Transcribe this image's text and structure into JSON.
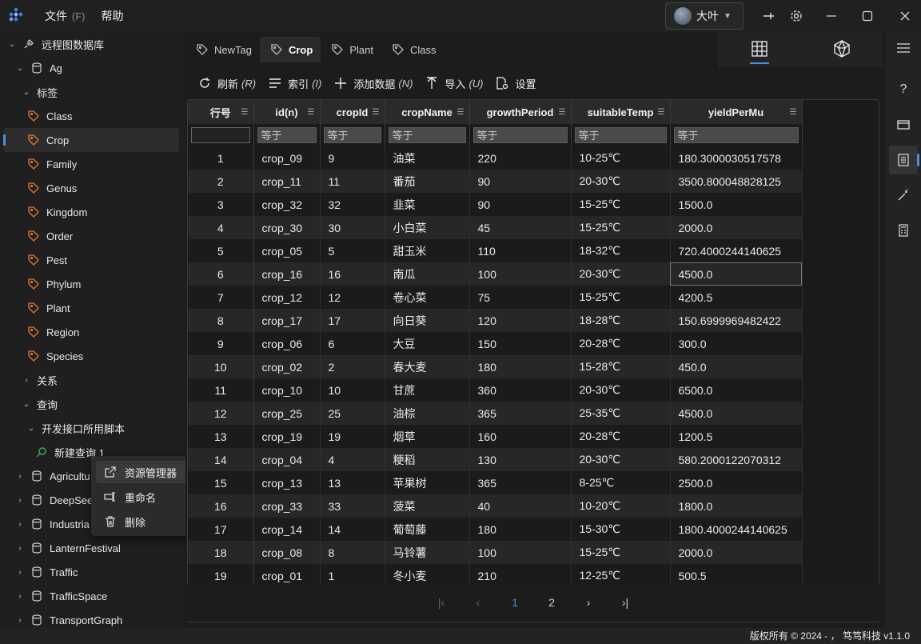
{
  "titlebar": {
    "menus": [
      {
        "label": "文件",
        "hint": "(F)"
      },
      {
        "label": "帮助",
        "hint": ""
      }
    ],
    "user_name": "大叶"
  },
  "sidebar": {
    "root": "远程图数据库",
    "db": "Ag",
    "tags_group": "标签",
    "tags": [
      "Class",
      "Crop",
      "Family",
      "Genus",
      "Kingdom",
      "Order",
      "Pest",
      "Phylum",
      "Plant",
      "Region",
      "Species"
    ],
    "selected_tag": "Crop",
    "relations_group": "关系",
    "query_group": "查询",
    "script_group": "开发接口所用脚本",
    "new_query": "新建查询 1",
    "databases": [
      "Agricultu",
      "DeepSee",
      "Industria",
      "LanternFestival",
      "Traffic",
      "TrafficSpace",
      "TransportGraph"
    ]
  },
  "context_menu": {
    "items": [
      "资源管理器",
      "重命名",
      "删除"
    ]
  },
  "tabs": [
    {
      "label": "NewTag",
      "active": false
    },
    {
      "label": "Crop",
      "active": true
    },
    {
      "label": "Plant",
      "active": false
    },
    {
      "label": "Class",
      "active": false
    }
  ],
  "toolbar": {
    "refresh": "刷新",
    "refresh_hint": "(R)",
    "index": "索引",
    "index_hint": "(I)",
    "add": "添加数据",
    "add_hint": "(N)",
    "import": "导入",
    "import_hint": "(U)",
    "settings": "设置"
  },
  "table": {
    "columns": [
      "行号",
      "id(n)",
      "cropId",
      "cropName",
      "growthPeriod",
      "suitableTemp",
      "yieldPerMu"
    ],
    "filter_placeholder": "等于",
    "rows": [
      [
        "1",
        "crop_09",
        "9",
        "油菜",
        "220",
        "10-25℃",
        "180.3000030517578"
      ],
      [
        "2",
        "crop_11",
        "11",
        "番茄",
        "90",
        "20-30℃",
        "3500.800048828125"
      ],
      [
        "3",
        "crop_32",
        "32",
        "韭菜",
        "90",
        "15-25℃",
        "1500.0"
      ],
      [
        "4",
        "crop_30",
        "30",
        "小白菜",
        "45",
        "15-25℃",
        "2000.0"
      ],
      [
        "5",
        "crop_05",
        "5",
        "甜玉米",
        "110",
        "18-32℃",
        "720.4000244140625"
      ],
      [
        "6",
        "crop_16",
        "16",
        "南瓜",
        "100",
        "20-30℃",
        "4500.0"
      ],
      [
        "7",
        "crop_12",
        "12",
        "卷心菜",
        "75",
        "15-25℃",
        "4200.5"
      ],
      [
        "8",
        "crop_17",
        "17",
        "向日葵",
        "120",
        "18-28℃",
        "150.6999969482422"
      ],
      [
        "9",
        "crop_06",
        "6",
        "大豆",
        "150",
        "20-28℃",
        "300.0"
      ],
      [
        "10",
        "crop_02",
        "2",
        "春大麦",
        "180",
        "15-28℃",
        "450.0"
      ],
      [
        "11",
        "crop_10",
        "10",
        "甘蔗",
        "360",
        "20-30℃",
        "6500.0"
      ],
      [
        "12",
        "crop_25",
        "25",
        "油棕",
        "365",
        "25-35℃",
        "4500.0"
      ],
      [
        "13",
        "crop_19",
        "19",
        "烟草",
        "160",
        "20-28℃",
        "1200.5"
      ],
      [
        "14",
        "crop_04",
        "4",
        "粳稻",
        "130",
        "20-30℃",
        "580.2000122070312"
      ],
      [
        "15",
        "crop_13",
        "13",
        "苹果树",
        "365",
        "8-25℃",
        "2500.0"
      ],
      [
        "16",
        "crop_33",
        "33",
        "菠菜",
        "40",
        "10-20℃",
        "1800.0"
      ],
      [
        "17",
        "crop_14",
        "14",
        "葡萄藤",
        "180",
        "15-30℃",
        "1800.4000244140625"
      ],
      [
        "18",
        "crop_08",
        "8",
        "马铃薯",
        "100",
        "15-25℃",
        "2000.0"
      ],
      [
        "19",
        "crop_01",
        "1",
        "冬小麦",
        "210",
        "12-25℃",
        "500.5"
      ]
    ]
  },
  "pager": {
    "pages": [
      "1",
      "2"
    ],
    "current": "1"
  },
  "statusbar": {
    "text": "版权所有 © 2024 - ， 笃笃科技 v1.1.0"
  },
  "colors": {
    "accent": "#4a90e2",
    "tag_icon": "#e07a3c",
    "query_icon": "#3ea55a"
  }
}
